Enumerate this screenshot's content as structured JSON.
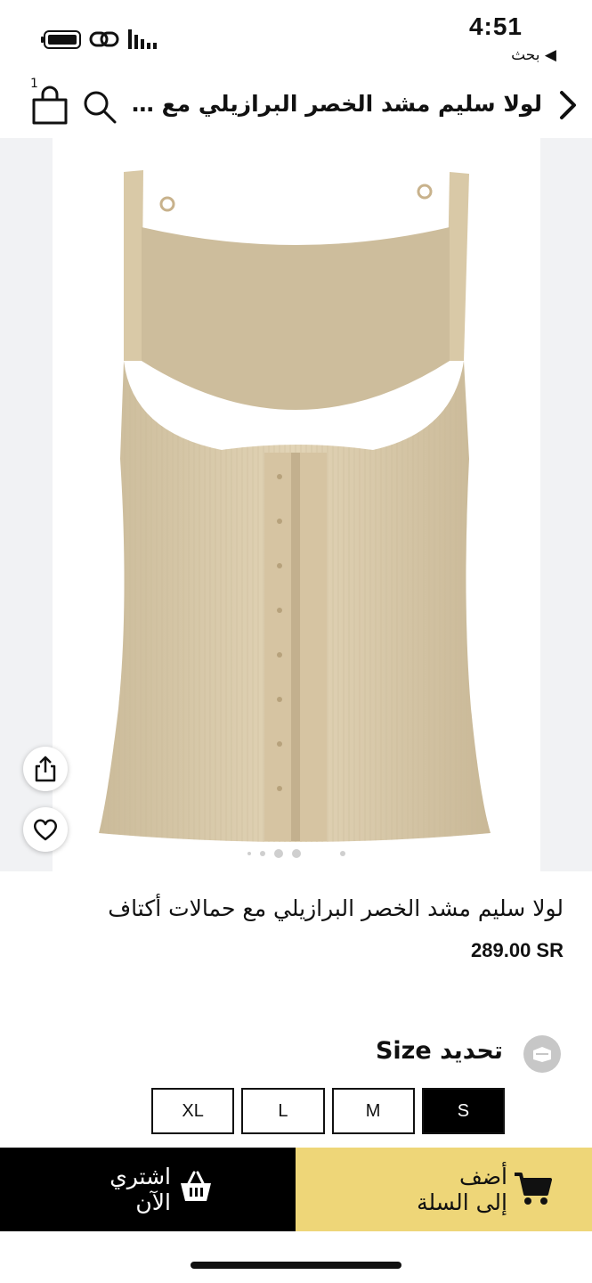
{
  "status_bar": {
    "time": "4:51",
    "back_app_label": "◀ بحث"
  },
  "header": {
    "title": "لولا سليم مشد الخصر البرازيلي مع دعامات",
    "cart_count": "1"
  },
  "gallery": {
    "image_count": 5,
    "active_index": 3
  },
  "product": {
    "name": "لولا سليم مشد الخصر البرازيلي مع حمالات أكتاف",
    "price": "289.00 SR"
  },
  "size_selector": {
    "label": "تحديد Size",
    "options": [
      "XL",
      "L",
      "M",
      "S"
    ],
    "selected": "S"
  },
  "actions": {
    "buy_now_line1": "اشتري",
    "buy_now_line2": "الآن",
    "add_to_cart_line1": "أضف",
    "add_to_cart_line2": "إلى السلة"
  },
  "colors": {
    "accent_yellow": "#eed678",
    "dark": "#000000",
    "product_beige": "#d8c9a9"
  }
}
